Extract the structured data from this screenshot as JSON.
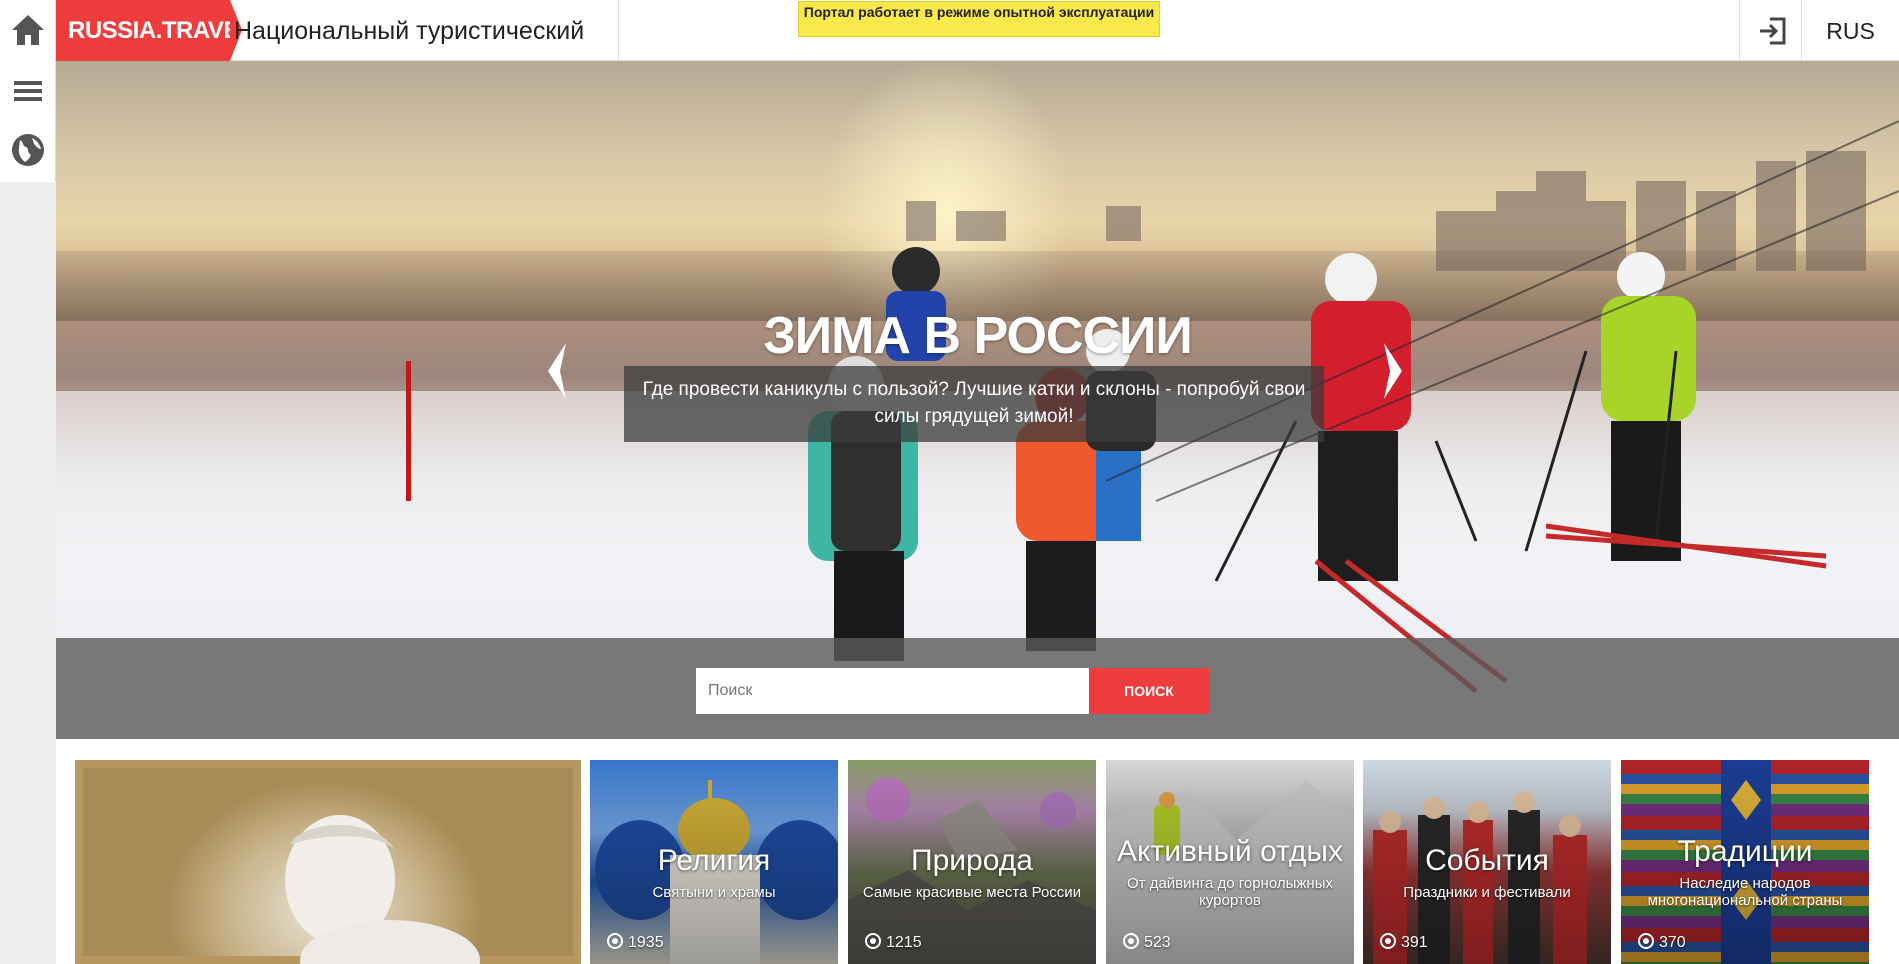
{
  "sidebar": {
    "icons": [
      "home-icon",
      "menu-icon",
      "globe-icon"
    ]
  },
  "header": {
    "logo": "RUSSIA.TRAVEL",
    "portal_title": "Национальный туристический портал",
    "beta_notice": "Портал работает в режиме опытной эксплуатации",
    "language": "RUS"
  },
  "hero": {
    "title": "ЗИМА В РОССИИ",
    "subtitle": "Где провести каникулы с пользой? Лучшие катки и склоны - попробуй свои силы грядущей зимой!",
    "search_placeholder": "Поиск",
    "search_button": "ПОИСК"
  },
  "categories": [
    {
      "name": "",
      "desc": "",
      "count": ""
    },
    {
      "name": "Религия",
      "desc": "Святыни и храмы",
      "count": "1935"
    },
    {
      "name": "Природа",
      "desc": "Самые красивые места России",
      "count": "1215"
    },
    {
      "name": "Активный отдых",
      "desc": "От дайвинга до горнолыжных курортов",
      "count": "523"
    },
    {
      "name": "События",
      "desc": "Праздники и фестивали",
      "count": "391"
    },
    {
      "name": "Традиции",
      "desc": "Наследие народов многонациональной страны",
      "count": "370"
    }
  ],
  "colors": {
    "accent": "#ef3c3c",
    "beta_bg": "#fbe84a"
  }
}
